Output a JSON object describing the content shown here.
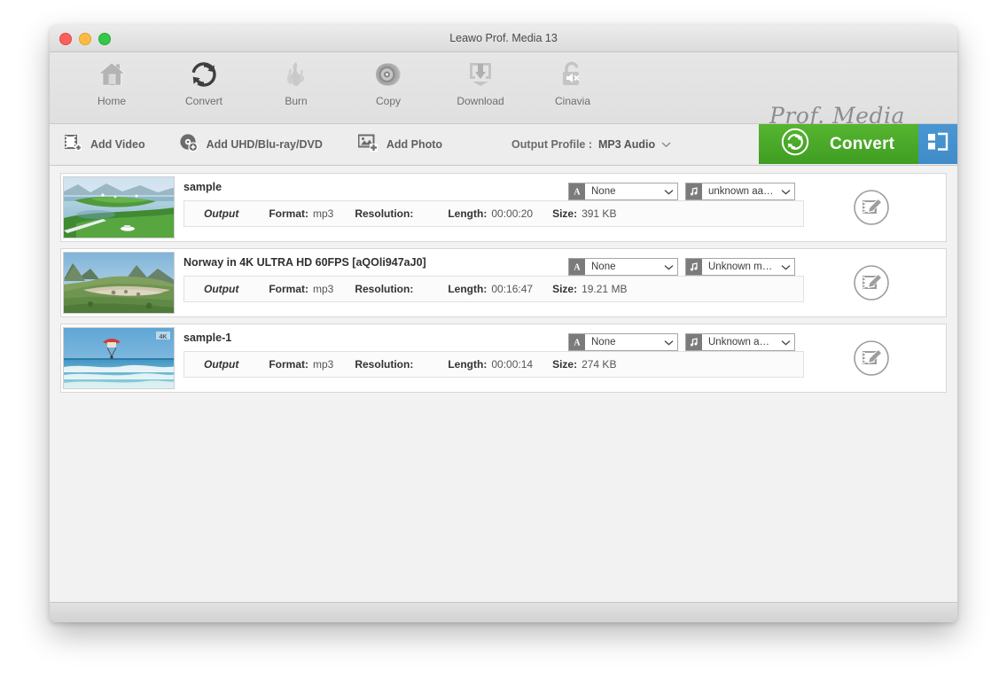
{
  "window": {
    "title": "Leawo Prof. Media 13",
    "traffic_lights": [
      "close",
      "minimize",
      "maximize"
    ]
  },
  "toolbar": {
    "items": [
      {
        "label": "Home",
        "icon": "home-icon"
      },
      {
        "label": "Convert",
        "icon": "convert-arrows-icon"
      },
      {
        "label": "Burn",
        "icon": "flame-icon"
      },
      {
        "label": "Copy",
        "icon": "disc-icon"
      },
      {
        "label": "Download",
        "icon": "download-icon"
      },
      {
        "label": "Cinavia",
        "icon": "unlock-mute-icon"
      }
    ],
    "brand": "Prof. Media"
  },
  "action_bar": {
    "add_video": "Add Video",
    "add_disc": "Add UHD/Blu-ray/DVD",
    "add_photo": "Add Photo",
    "output_profile_label": "Output Profile :",
    "output_profile_value": "MP3 Audio",
    "convert_label": "Convert",
    "convert_color": "#4aa827",
    "panel_toggle_color": "#4490ce"
  },
  "meta_labels": {
    "output": "Output",
    "format": "Format:",
    "resolution": "Resolution:",
    "length": "Length:",
    "size": "Size:"
  },
  "media_list": [
    {
      "title": "sample",
      "format": "mp3",
      "resolution": "",
      "length": "00:00:20",
      "size": "391 KB",
      "subtitle_track": "None",
      "audio_track": "unknown aa…",
      "thumb": "fjord-green-islands"
    },
    {
      "title": "Norway in 4K ULTRA HD 60FPS [aQOli947aJ0]",
      "format": "mp3",
      "resolution": "",
      "length": "00:16:47",
      "size": "19.21 MB",
      "subtitle_track": "None",
      "audio_track": "Unknown m…",
      "thumb": "mountain-valley-green"
    },
    {
      "title": "sample-1",
      "format": "mp3",
      "resolution": "",
      "length": "00:00:14",
      "size": "274 KB",
      "subtitle_track": "None",
      "audio_track": "Unknown a…",
      "thumb": "ocean-parasail-beach"
    }
  ]
}
